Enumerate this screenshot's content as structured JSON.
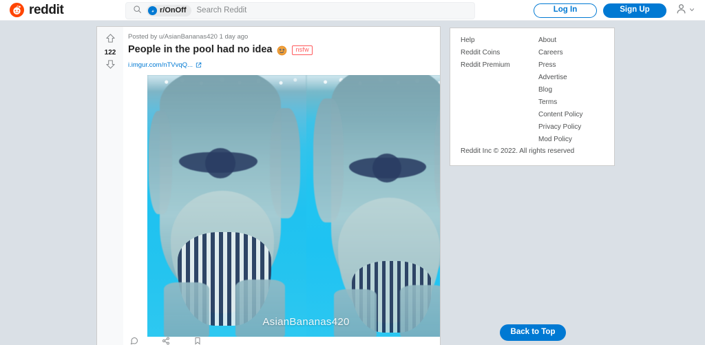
{
  "header": {
    "brand_name": "reddit",
    "brand_logo_icon": "reddit-alien-icon",
    "search": {
      "icon": "search-icon",
      "subreddit_chip": "r/OnOff",
      "subreddit_avatar_icon": "subreddit-avatar-icon",
      "placeholder": "Search Reddit",
      "value": ""
    },
    "login_label": "Log In",
    "signup_label": "Sign Up",
    "user_icon": "user-avatar-icon",
    "user_chevron_icon": "chevron-down-icon"
  },
  "post": {
    "upvote_icon": "upvote-arrow-icon",
    "downvote_icon": "downvote-arrow-icon",
    "score": "122",
    "meta": "Posted by u/AsianBananas420 1 day ago",
    "author": "u/AsianBananas420",
    "age": "1 day ago",
    "title": "People in the pool had no idea",
    "title_emoji_icon": "smirking-face-emoji",
    "nsfw_label": "nsfw",
    "link_text": "i.imgur.com/nTVvqQ...",
    "link_external_icon": "external-link-icon",
    "image": {
      "alt": "underwater pool photo, two-panel",
      "watermark": "AsianBananas420"
    },
    "actions": [
      {
        "label": "",
        "icon": "comment-icon"
      },
      {
        "label": "",
        "icon": "share-icon"
      },
      {
        "label": "",
        "icon": "save-icon"
      }
    ]
  },
  "footer": {
    "columns": [
      {
        "links": [
          "Help",
          "Reddit Coins",
          "Reddit Premium"
        ]
      },
      {
        "links": [
          "About",
          "Careers",
          "Press",
          "Advertise",
          "Blog",
          "Terms",
          "Content Policy",
          "Privacy Policy",
          "Mod Policy"
        ]
      }
    ],
    "copyright": "Reddit Inc © 2022. All rights reserved"
  },
  "back_to_top": {
    "label": "Back to Top"
  },
  "colors": {
    "page_background": "#dae0e6",
    "brand_orange": "#ff4500",
    "accent_blue": "#0079d3",
    "nsfw_red": "#ff585b",
    "text_primary": "#1a1a1b",
    "text_muted": "#787c7e",
    "card_white": "#ffffff"
  }
}
